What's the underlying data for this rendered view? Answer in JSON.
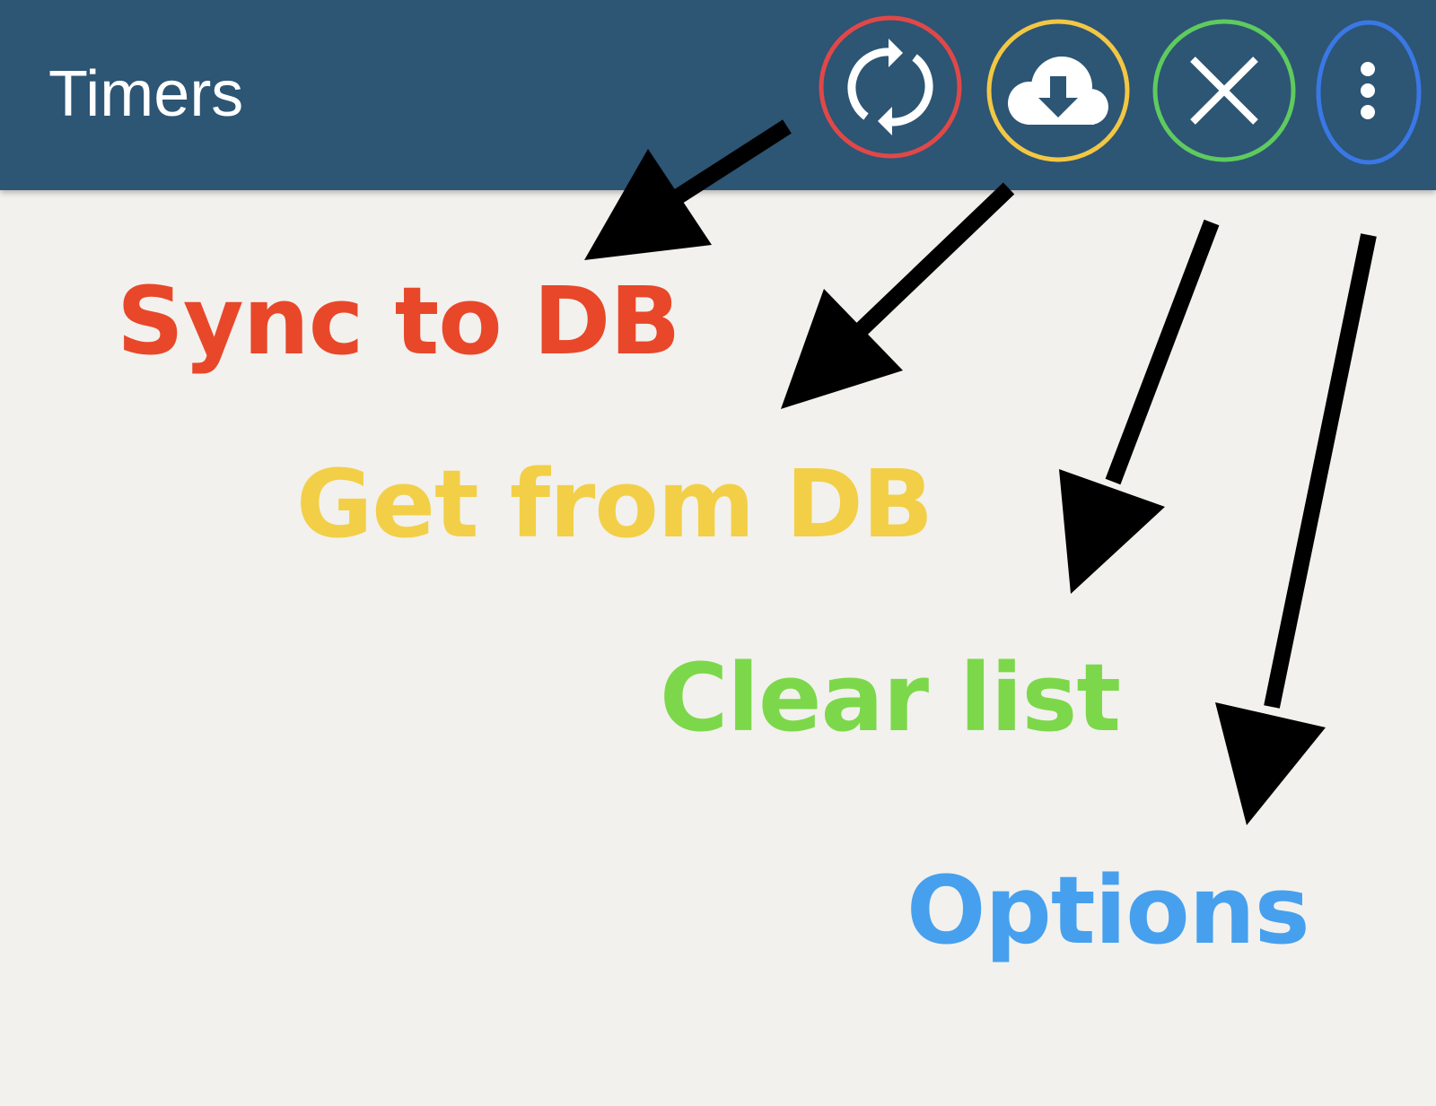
{
  "toolbar": {
    "title": "Timers",
    "background": "#2d5574",
    "actions": [
      {
        "icon": "sync-icon",
        "ring_color": "#e04848"
      },
      {
        "icon": "cloud-download-icon",
        "ring_color": "#f2c744"
      },
      {
        "icon": "close-icon",
        "ring_color": "#5ecb5e"
      },
      {
        "icon": "more-vert-icon",
        "ring_color": "#3a78e6"
      }
    ]
  },
  "annotations": {
    "sync": {
      "label": "Sync to DB",
      "color": "#e8472a"
    },
    "get": {
      "label": "Get from DB",
      "color": "#f2cf46"
    },
    "clear": {
      "label": "Clear list",
      "color": "#7cd84a"
    },
    "options": {
      "label": "Options",
      "color": "#46a0ee"
    }
  }
}
